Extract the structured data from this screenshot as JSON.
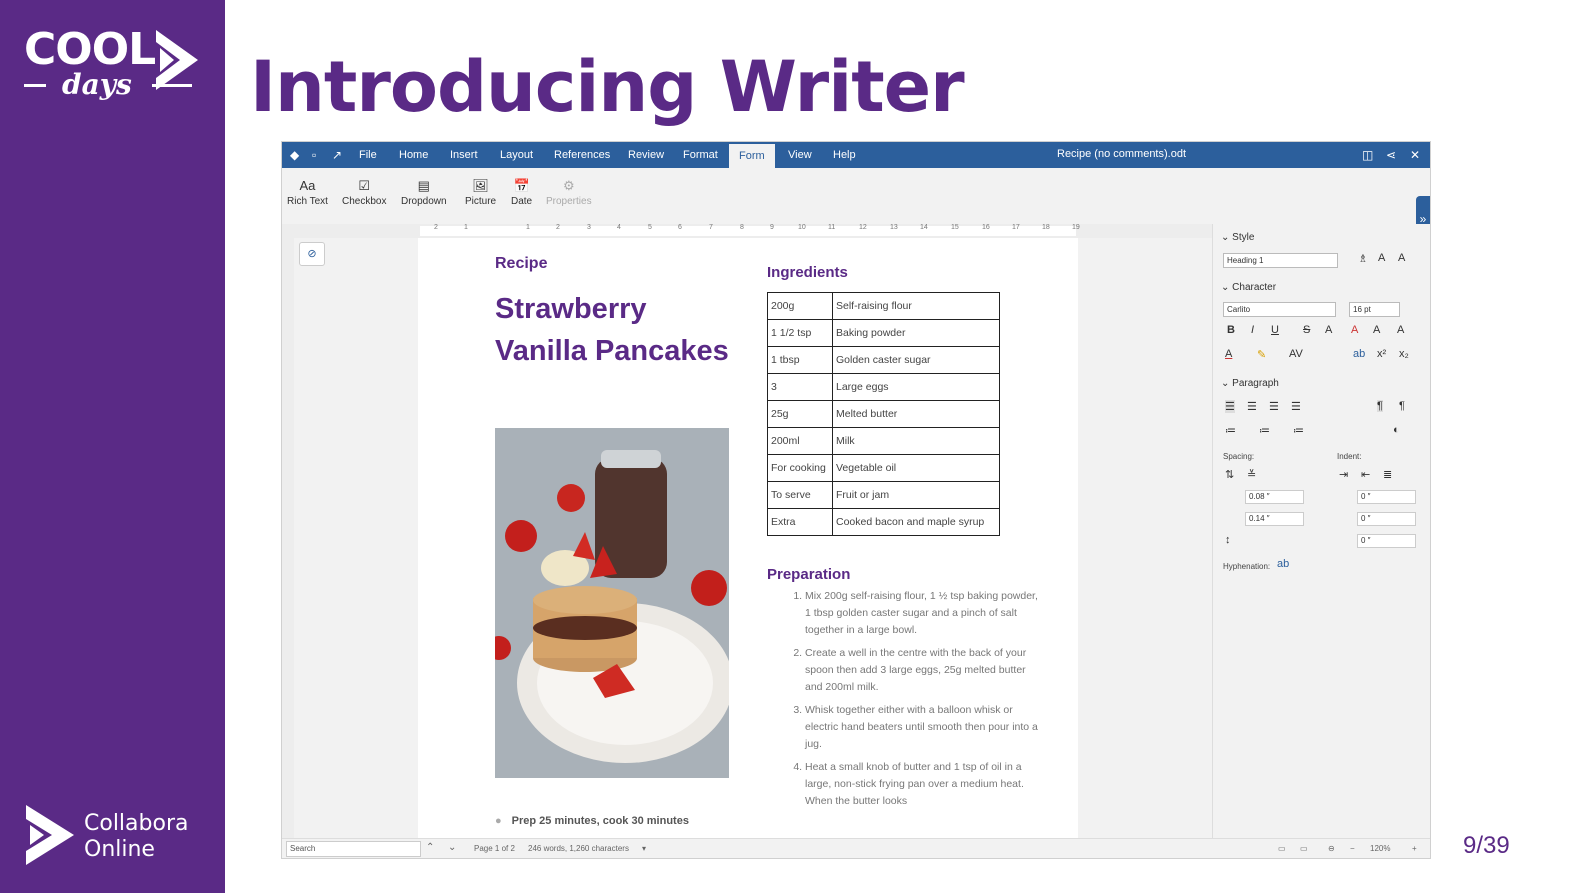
{
  "slide": {
    "title": "Introducing Writer",
    "page_number": "9/39",
    "logo_cool": "COOL",
    "logo_days": "days",
    "brand": "Collabora\nOnline",
    "brand_line1": "Collabora",
    "brand_line2": "Online"
  },
  "app": {
    "document_title": "Recipe (no comments).odt",
    "menu": [
      "File",
      "Home",
      "Insert",
      "Layout",
      "References",
      "Review",
      "Format",
      "Form",
      "View",
      "Help"
    ],
    "active_menu": "Form",
    "toolbar": [
      {
        "label": "Rich Text",
        "icon": "Aa"
      },
      {
        "label": "Checkbox",
        "icon": "☑"
      },
      {
        "label": "Dropdown",
        "icon": "▤"
      },
      {
        "label": "Picture",
        "icon": "🖼"
      },
      {
        "label": "Date",
        "icon": "📅"
      },
      {
        "label": "Properties",
        "icon": "⚙"
      }
    ],
    "ruler_ticks": [
      "2",
      "1",
      "1",
      "2",
      "3",
      "4",
      "5",
      "6",
      "7",
      "8",
      "9",
      "10",
      "11",
      "12",
      "13",
      "14",
      "15",
      "16",
      "17",
      "18",
      "19"
    ]
  },
  "document": {
    "kicker": "Recipe",
    "dish_title": "Strawberry Vanilla Pancakes",
    "ingredients_heading": "Ingredients",
    "ingredients": [
      [
        "200g",
        "Self-raising flour"
      ],
      [
        "1 1/2 tsp",
        "Baking powder"
      ],
      [
        "1 tbsp",
        "Golden caster sugar"
      ],
      [
        "3",
        "Large eggs"
      ],
      [
        "25g",
        "Melted butter"
      ],
      [
        "200ml",
        "Milk"
      ],
      [
        "For cooking",
        "Vegetable oil"
      ],
      [
        "To serve",
        "Fruit or jam"
      ],
      [
        "Extra",
        "Cooked bacon and maple syrup"
      ]
    ],
    "preparation_heading": "Preparation",
    "steps": [
      "Mix 200g self-raising flour, 1 ½ tsp baking powder, 1 tbsp golden caster sugar and a pinch of salt together in a large bowl.",
      "Create a well in the centre with the back of your spoon then add 3 large eggs, 25g melted butter and 200ml milk.",
      "Whisk together either with a balloon whisk or electric hand beaters until smooth then pour into a jug.",
      "Heat a small knob of butter and 1 tsp of oil in a large, non-stick frying pan over a medium heat. When the butter looks"
    ],
    "prep_note": "Prep 25 minutes, cook 30 minutes"
  },
  "sidebar_panel": {
    "style_section": "Style",
    "paragraph_style": "Heading 1",
    "character_section": "Character",
    "font_name": "Carlito",
    "font_size": "16 pt",
    "paragraph_section": "Paragraph",
    "spacing_label": "Spacing:",
    "indent_label": "Indent:",
    "spacing_above": "0.08 ″",
    "spacing_below": "0.14 ″",
    "indent_before": "0 ″",
    "indent_after": "0 ″",
    "indent_first": "0 ″",
    "hyphenation_label": "Hyphenation:"
  },
  "statusbar": {
    "search_placeholder": "Search",
    "page_info": "Page 1 of 2",
    "word_info": "246 words, 1,260 characters",
    "zoom": "120%"
  },
  "colors": {
    "brand_purple": "#5a2a86",
    "menubar_blue": "#2c5f9c"
  }
}
